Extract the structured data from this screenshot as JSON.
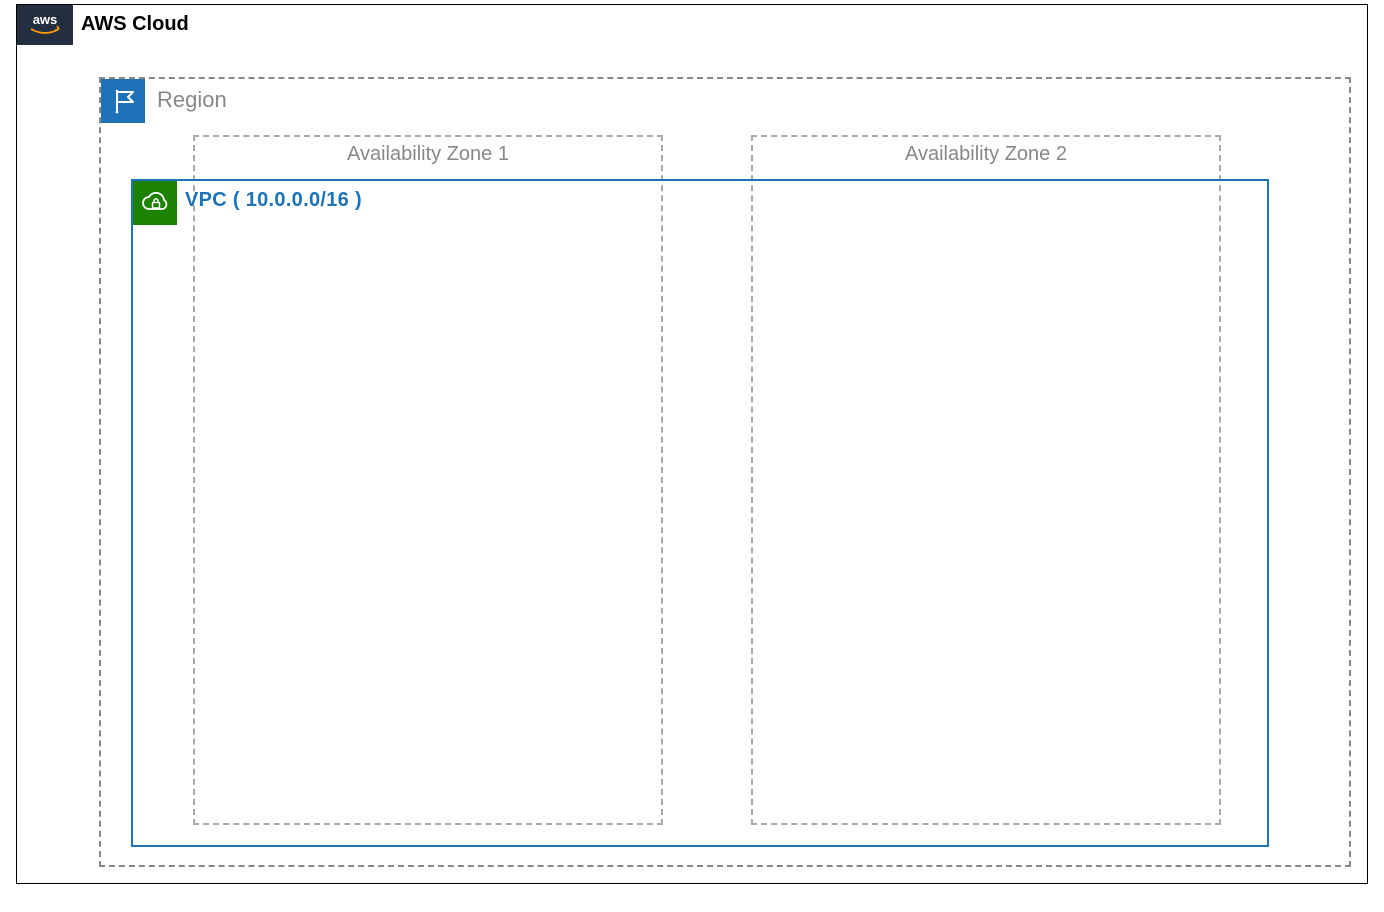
{
  "cloud": {
    "label": "AWS Cloud"
  },
  "region": {
    "label": "Region"
  },
  "vpc": {
    "label": "VPC  ( 10.0.0.0/16 )"
  },
  "azs": [
    {
      "label": "Availability Zone 1"
    },
    {
      "label": "Availability Zone 2"
    }
  ],
  "colors": {
    "aws_badge_bg": "#232f3e",
    "region_badge_bg": "#1e73b8",
    "vpc_border": "#1e73b8",
    "vpc_badge_bg": "#1d8102",
    "dash_gray": "#888"
  }
}
